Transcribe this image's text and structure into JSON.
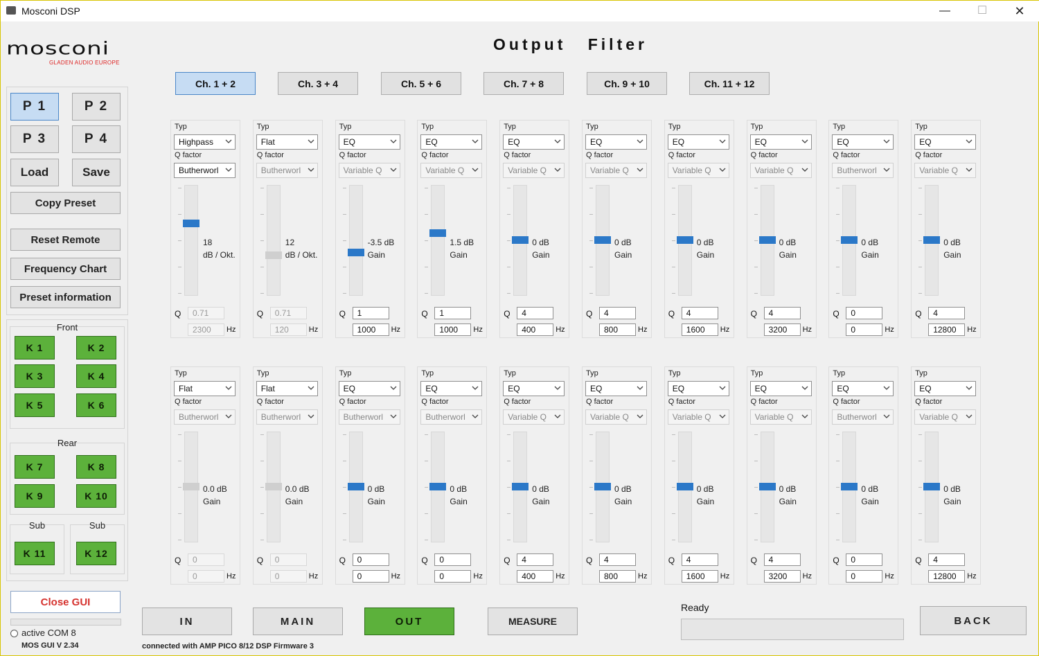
{
  "window": {
    "title": "Mosconi DSP",
    "min": "—",
    "max": "☐",
    "close": "✕"
  },
  "logo": {
    "word": "mosconi",
    "sub": "GLADEN AUDIO EUROPE"
  },
  "presets": [
    {
      "label": "P 1",
      "selected": true
    },
    {
      "label": "P 2",
      "selected": false
    },
    {
      "label": "P 3",
      "selected": false
    },
    {
      "label": "P 4",
      "selected": false
    }
  ],
  "actions": {
    "load": "Load",
    "save": "Save",
    "copy": "Copy Preset",
    "reset": "Reset Remote",
    "freq": "Frequency Chart",
    "info": "Preset information"
  },
  "groups": {
    "front": "Front",
    "rear": "Rear",
    "sub1": "Sub",
    "sub2": "Sub"
  },
  "channels": [
    "K 1",
    "K 2",
    "K 3",
    "K 4",
    "K 5",
    "K 6",
    "K 7",
    "K 8",
    "K 9",
    "K 10",
    "K 11",
    "K 12"
  ],
  "close_gui": "Close GUI",
  "status": {
    "com": "active COM 8",
    "version": "MOS GUI V 2.34",
    "connected": "connected with AMP PICO 8/12 DSP Firmware 3",
    "ready": "Ready"
  },
  "page_title": "Output Filter",
  "tabs": [
    {
      "label": "Ch. 1 + 2",
      "selected": true
    },
    {
      "label": "Ch. 3 + 4",
      "selected": false
    },
    {
      "label": "Ch. 5 + 6",
      "selected": false
    },
    {
      "label": "Ch. 7 + 8",
      "selected": false
    },
    {
      "label": "Ch. 9 + 10",
      "selected": false
    },
    {
      "label": "Ch. 11 + 12",
      "selected": false
    }
  ],
  "labels": {
    "type": "Typ",
    "qfactor": "Q factor",
    "q": "Q",
    "hz": "Hz"
  },
  "rows": [
    [
      {
        "type": "Highpass",
        "qsel": "Butherworl",
        "qsel_dis": false,
        "v1": "18",
        "v2": "dB / Okt.",
        "level": 0.66,
        "thumb_dis": false,
        "q": "0.71",
        "f": "2300",
        "q_dis": true
      },
      {
        "type": "Flat",
        "qsel": "Butherworl",
        "qsel_dis": true,
        "v1": "12",
        "v2": "dB / Okt.",
        "level": 0.35,
        "thumb_dis": true,
        "q": "0.71",
        "f": "120",
        "q_dis": true
      },
      {
        "type": "EQ",
        "qsel": "Variable Q",
        "qsel_dis": true,
        "v1": "-3.5 dB",
        "v2": "Gain",
        "level": 0.38,
        "thumb_dis": false,
        "q": "1",
        "f": "1000",
        "q_dis": false
      },
      {
        "type": "EQ",
        "qsel": "Variable Q",
        "qsel_dis": true,
        "v1": "1.5 dB",
        "v2": "Gain",
        "level": 0.57,
        "thumb_dis": false,
        "q": "1",
        "f": "1000",
        "q_dis": false
      },
      {
        "type": "EQ",
        "qsel": "Variable Q",
        "qsel_dis": true,
        "v1": "0 dB",
        "v2": "Gain",
        "level": 0.5,
        "thumb_dis": false,
        "q": "4",
        "f": "400",
        "q_dis": false
      },
      {
        "type": "EQ",
        "qsel": "Variable Q",
        "qsel_dis": true,
        "v1": "0 dB",
        "v2": "Gain",
        "level": 0.5,
        "thumb_dis": false,
        "q": "4",
        "f": "800",
        "q_dis": false
      },
      {
        "type": "EQ",
        "qsel": "Variable Q",
        "qsel_dis": true,
        "v1": "0 dB",
        "v2": "Gain",
        "level": 0.5,
        "thumb_dis": false,
        "q": "4",
        "f": "1600",
        "q_dis": false
      },
      {
        "type": "EQ",
        "qsel": "Variable Q",
        "qsel_dis": true,
        "v1": "0 dB",
        "v2": "Gain",
        "level": 0.5,
        "thumb_dis": false,
        "q": "4",
        "f": "3200",
        "q_dis": false
      },
      {
        "type": "EQ",
        "qsel": "Butherworl",
        "qsel_dis": true,
        "v1": "0 dB",
        "v2": "Gain",
        "level": 0.5,
        "thumb_dis": false,
        "q": "0",
        "f": "0",
        "q_dis": false
      },
      {
        "type": "EQ",
        "qsel": "Variable Q",
        "qsel_dis": true,
        "v1": "0 dB",
        "v2": "Gain",
        "level": 0.5,
        "thumb_dis": false,
        "q": "4",
        "f": "12800",
        "q_dis": false
      }
    ],
    [
      {
        "type": "Flat",
        "qsel": "Butherworl",
        "qsel_dis": true,
        "v1": "0.0 dB",
        "v2": "Gain",
        "level": 0.5,
        "thumb_dis": true,
        "q": "0",
        "f": "0",
        "q_dis": true
      },
      {
        "type": "Flat",
        "qsel": "Butherworl",
        "qsel_dis": true,
        "v1": "0.0 dB",
        "v2": "Gain",
        "level": 0.5,
        "thumb_dis": true,
        "q": "0",
        "f": "0",
        "q_dis": true
      },
      {
        "type": "EQ",
        "qsel": "Butherworl",
        "qsel_dis": true,
        "v1": "0 dB",
        "v2": "Gain",
        "level": 0.5,
        "thumb_dis": false,
        "q": "0",
        "f": "0",
        "q_dis": false
      },
      {
        "type": "EQ",
        "qsel": "Butherworl",
        "qsel_dis": true,
        "v1": "0 dB",
        "v2": "Gain",
        "level": 0.5,
        "thumb_dis": false,
        "q": "0",
        "f": "0",
        "q_dis": false
      },
      {
        "type": "EQ",
        "qsel": "Variable Q",
        "qsel_dis": true,
        "v1": "0 dB",
        "v2": "Gain",
        "level": 0.5,
        "thumb_dis": false,
        "q": "4",
        "f": "400",
        "q_dis": false
      },
      {
        "type": "EQ",
        "qsel": "Variable Q",
        "qsel_dis": true,
        "v1": "0 dB",
        "v2": "Gain",
        "level": 0.5,
        "thumb_dis": false,
        "q": "4",
        "f": "800",
        "q_dis": false
      },
      {
        "type": "EQ",
        "qsel": "Variable Q",
        "qsel_dis": true,
        "v1": "0 dB",
        "v2": "Gain",
        "level": 0.5,
        "thumb_dis": false,
        "q": "4",
        "f": "1600",
        "q_dis": false
      },
      {
        "type": "EQ",
        "qsel": "Variable Q",
        "qsel_dis": true,
        "v1": "0 dB",
        "v2": "Gain",
        "level": 0.5,
        "thumb_dis": false,
        "q": "4",
        "f": "3200",
        "q_dis": false
      },
      {
        "type": "EQ",
        "qsel": "Butherworl",
        "qsel_dis": true,
        "v1": "0 dB",
        "v2": "Gain",
        "level": 0.5,
        "thumb_dis": false,
        "q": "0",
        "f": "0",
        "q_dis": false
      },
      {
        "type": "EQ",
        "qsel": "Variable Q",
        "qsel_dis": true,
        "v1": "0 dB",
        "v2": "Gain",
        "level": 0.5,
        "thumb_dis": false,
        "q": "4",
        "f": "12800",
        "q_dis": false
      }
    ]
  ],
  "nav": {
    "in": "IN",
    "main": "MAIN",
    "out": "OUT",
    "measure": "MEASURE",
    "back": "BACK"
  }
}
